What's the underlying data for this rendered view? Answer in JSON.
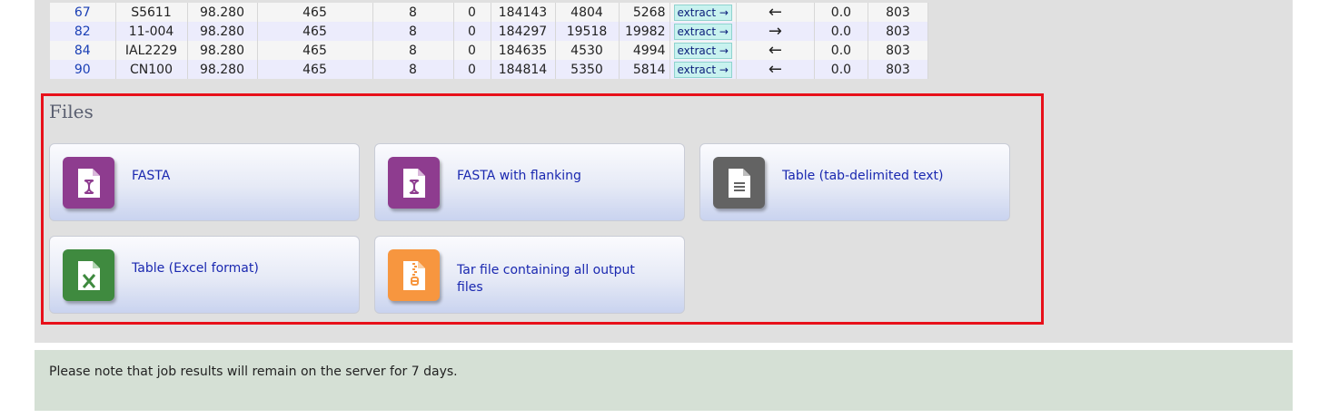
{
  "results_table": {
    "rows": [
      {
        "id": "67",
        "strain": "S5611",
        "identity": "98.280",
        "length": "465",
        "mismatches": "8",
        "gaps": "0",
        "seq_start": "184143",
        "q_start": "4804",
        "q_end": "5268",
        "extract_label": "extract →",
        "strand": "←",
        "evalue": "0.0",
        "score": "803"
      },
      {
        "id": "82",
        "strain": "11-004",
        "identity": "98.280",
        "length": "465",
        "mismatches": "8",
        "gaps": "0",
        "seq_start": "184297",
        "q_start": "19518",
        "q_end": "19982",
        "extract_label": "extract →",
        "strand": "→",
        "evalue": "0.0",
        "score": "803"
      },
      {
        "id": "84",
        "strain": "IAL2229",
        "identity": "98.280",
        "length": "465",
        "mismatches": "8",
        "gaps": "0",
        "seq_start": "184635",
        "q_start": "4530",
        "q_end": "4994",
        "extract_label": "extract →",
        "strand": "←",
        "evalue": "0.0",
        "score": "803"
      },
      {
        "id": "90",
        "strain": "CN100",
        "identity": "98.280",
        "length": "465",
        "mismatches": "8",
        "gaps": "0",
        "seq_start": "184814",
        "q_start": "5350",
        "q_end": "5814",
        "extract_label": "extract →",
        "strand": "←",
        "evalue": "0.0",
        "score": "803"
      }
    ]
  },
  "files": {
    "title": "Files",
    "items": [
      {
        "label": "FASTA",
        "icon": "dna-file-icon",
        "color": "#8e3c8f"
      },
      {
        "label": "FASTA with flanking",
        "icon": "dna-file-icon",
        "color": "#8e3c8f"
      },
      {
        "label": "Table (tab-delimited text)",
        "icon": "text-file-icon",
        "color": "#636363"
      },
      {
        "label": "Table (Excel format)",
        "icon": "excel-file-icon",
        "color": "#3f8a3f"
      },
      {
        "label": "Tar file containing all output files",
        "icon": "zip-file-icon",
        "color": "#f7963f"
      }
    ]
  },
  "note": {
    "text": "Please note that job results will remain on the server for 7 days."
  },
  "colors": {
    "highlight_border": "#e8101a",
    "link": "#1a28b0",
    "panel_bg": "#e0e0e0",
    "note_bg": "#d5e0d5"
  }
}
